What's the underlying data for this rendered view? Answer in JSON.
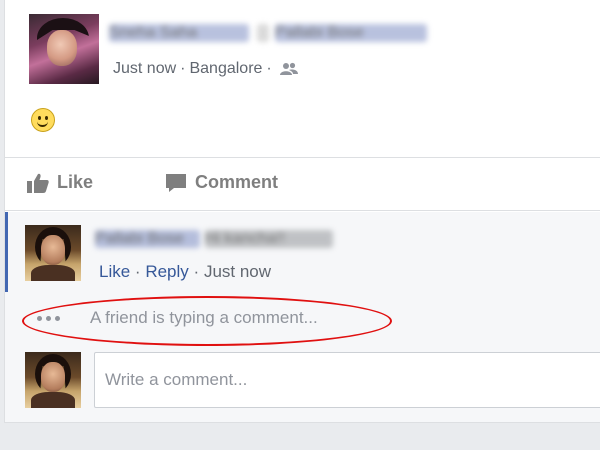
{
  "post": {
    "author": "Sneha Saha",
    "tagged": "Pallabi Bose",
    "time": "Just now",
    "location": "Bangalore",
    "sep": "·",
    "audience_icon": "friends-icon",
    "content_icon": "smiley-emoji"
  },
  "actions": {
    "like": "Like",
    "comment": "Comment"
  },
  "comment": {
    "author": "Pallabi Bose",
    "text": "Hi kancha!!",
    "like": "Like",
    "sep": "·",
    "reply": "Reply",
    "time": "Just now"
  },
  "typing_indicator": {
    "text": "A friend is typing a comment..."
  },
  "composer": {
    "placeholder": "Write a comment..."
  },
  "colors": {
    "link": "#365899",
    "highlight": "#e01010",
    "active_bar": "#4267b2"
  }
}
